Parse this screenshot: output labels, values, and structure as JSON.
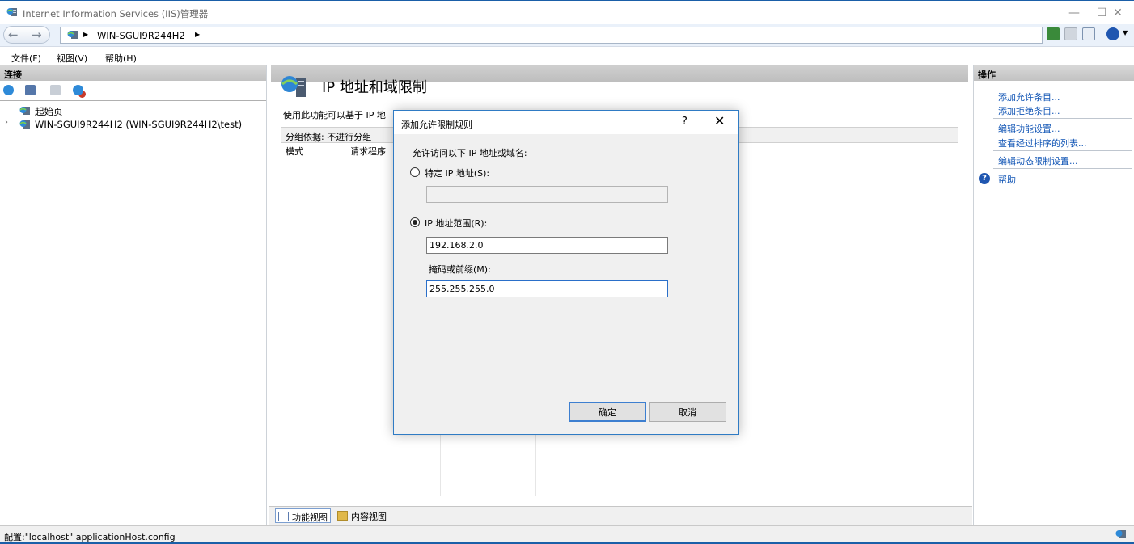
{
  "window": {
    "title": "Internet Information Services (IIS)管理器",
    "minimize": "—",
    "maximize": "☐",
    "close": "✕"
  },
  "navigation": {
    "back": "←",
    "forward": "→",
    "address_segment": "WIN-SGUI9R244H2"
  },
  "menu": {
    "file": "文件(F)",
    "view": "视图(V)",
    "help": "帮助(H)"
  },
  "connections": {
    "header": "连接",
    "tree": [
      {
        "label": "起始页"
      },
      {
        "label": "WIN-SGUI9R244H2 (WIN-SGUI9R244H2\\test)"
      }
    ]
  },
  "feature": {
    "title": "IP 地址和域限制",
    "description": "使用此功能可以基于 IP 地",
    "group_by_label": "分组依据:",
    "group_by_value": "不进行分组",
    "columns": [
      "模式",
      "请求程序"
    ]
  },
  "bottom_tabs": {
    "features_view": "功能视图",
    "content_view": "内容视图"
  },
  "actions": {
    "header": "操作",
    "items": [
      "添加允许条目...",
      "添加拒绝条目...",
      "编辑功能设置...",
      "查看经过排序的列表...",
      "编辑动态限制设置...",
      "帮助"
    ]
  },
  "status": {
    "text": "配置:\"localhost\" applicationHost.config"
  },
  "dialog": {
    "title": "添加允许限制规则",
    "help": "?",
    "close": "✕",
    "instruction": "允许访问以下 IP 地址或域名:",
    "specific_ip_label": "特定 IP 地址(S):",
    "specific_ip_value": "",
    "range_label": "IP 地址范围(R):",
    "range_value": "192.168.2.0",
    "mask_label": "掩码或前缀(M):",
    "mask_value": "255.255.255.0",
    "ok": "确定",
    "cancel": "取消",
    "selected_option": "ip_range"
  },
  "colors": {
    "accent": "#1a5fa8",
    "link": "#1155b5",
    "dialog_border": "#2f7bc4"
  }
}
